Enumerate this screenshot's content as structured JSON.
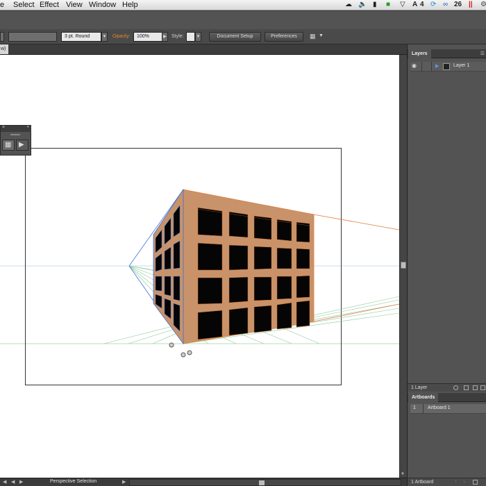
{
  "menubar": {
    "items": [
      "e",
      "Select",
      "Effect",
      "View",
      "Window",
      "Help"
    ],
    "status": {
      "adobe_count": "4",
      "cc_count": "26"
    }
  },
  "controlbar": {
    "stroke_profile": "3 pt. Round",
    "opacity_label": "Opacity:",
    "opacity_value": "100%",
    "style_label": "Style:",
    "document_setup": "Document Setup",
    "preferences": "Preferences"
  },
  "document_tab": {
    "label": "w)"
  },
  "statusbar": {
    "tool": "Perspective Selection"
  },
  "layers_panel": {
    "title": "Layers",
    "rows": [
      {
        "name": "Layer 1"
      }
    ],
    "footer": "1 Layer"
  },
  "artboards_panel": {
    "title": "Artboards",
    "rows": [
      {
        "index": "1",
        "name": "Artboard 1"
      }
    ],
    "footer": "1 Artboard"
  },
  "colors": {
    "accent_orange": "#e08a2c",
    "building_face": "#c8936a",
    "grid_left": "#3f6fd6",
    "grid_ground": "#5fae6a",
    "grid_right": "#e07a3a",
    "selection_blue": "#2f69d9"
  }
}
